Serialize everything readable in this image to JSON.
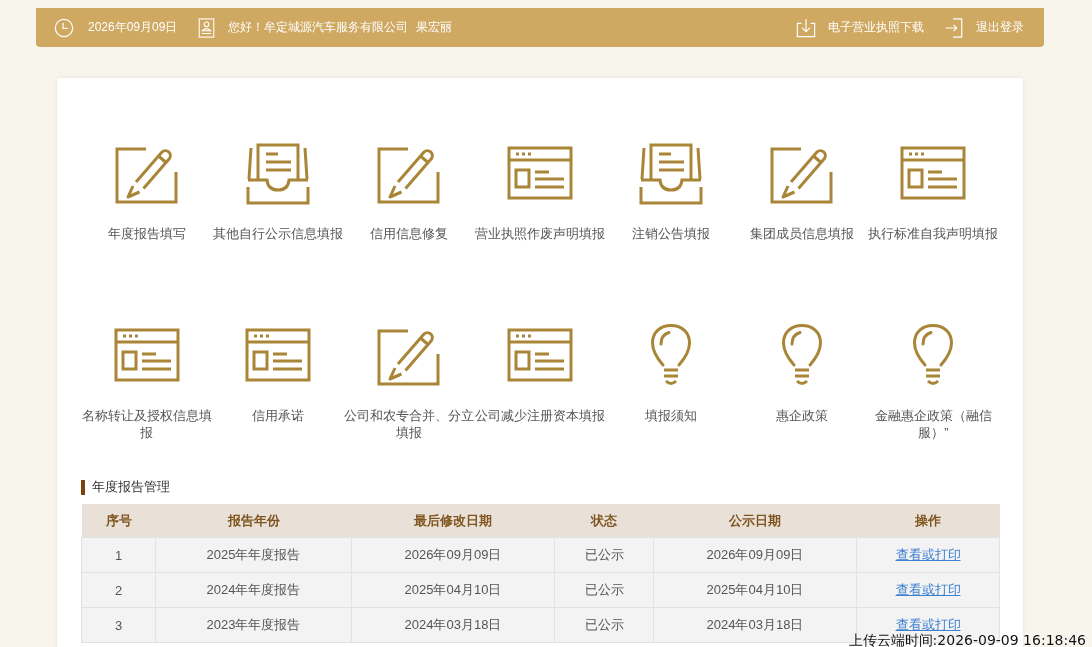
{
  "header": {
    "date": "2026年09月09日",
    "greeting": "您好！牟定城源汽车服务有限公司",
    "user_name": "果宏丽",
    "actions": [
      {
        "label": "电子营业执照下载",
        "kind": "download"
      },
      {
        "label": "退出登录",
        "kind": "logout"
      }
    ]
  },
  "services": [
    {
      "label": "年度报告填写",
      "kind": "edit"
    },
    {
      "label": "其他自行公示信息填报",
      "kind": "tray"
    },
    {
      "label": "信用信息修复",
      "kind": "edit"
    },
    {
      "label": "营业执照作废声明填报",
      "kind": "form"
    },
    {
      "label": "注销公告填报",
      "kind": "tray"
    },
    {
      "label": "集团成员信息填报",
      "kind": "edit"
    },
    {
      "label": "执行标准自我声明填报",
      "kind": "form"
    },
    {
      "label": "名称转让及授权信息填报",
      "kind": "form"
    },
    {
      "label": "信用承诺",
      "kind": "form"
    },
    {
      "label": "公司和农专合并、分立填报",
      "kind": "edit"
    },
    {
      "label": "公司减少注册资本填报",
      "kind": "form"
    },
    {
      "label": "填报须知",
      "kind": "bulb"
    },
    {
      "label": "惠企政策",
      "kind": "bulb"
    },
    {
      "label": "金融惠企政策（融信服）”",
      "kind": "bulb"
    }
  ],
  "annual_reports": {
    "title": "年度报告管理",
    "columns": [
      "序号",
      "报告年份",
      "最后修改日期",
      "状态",
      "公示日期",
      "操作"
    ],
    "rows": [
      {
        "cells": [
          "1",
          "2025年年度报告",
          "2026年09月09日",
          "已公示",
          "2026年09月09日"
        ],
        "action": "查看或打印"
      },
      {
        "cells": [
          "2",
          "2024年年度报告",
          "2025年04月10日",
          "已公示",
          "2025年04月10日"
        ],
        "action": "查看或打印"
      },
      {
        "cells": [
          "3",
          "2023年年度报告",
          "2024年03月18日",
          "已公示",
          "2024年03月18日"
        ],
        "action": "查看或打印"
      }
    ]
  },
  "upload_stamp": "上传云端时间:2026-09-09 16:18:46"
}
